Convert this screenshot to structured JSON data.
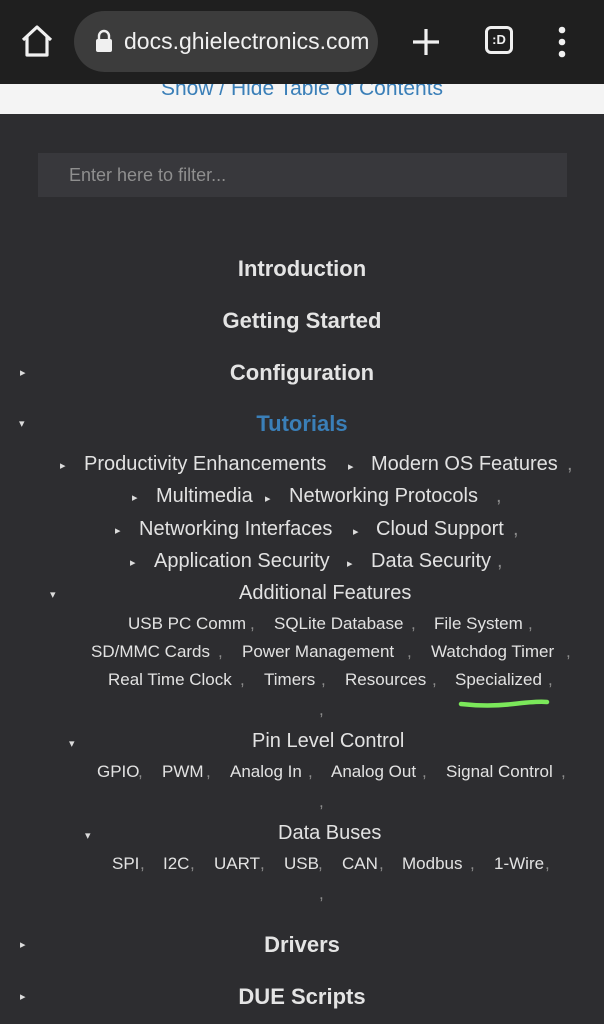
{
  "browser": {
    "url": "docs.ghielectronics.com",
    "tabs_label": ":D"
  },
  "toc": {
    "toggle_label": "Show / Hide Table of Contents",
    "filter_placeholder": "Enter here to filter...",
    "top_items": {
      "introduction": "Introduction",
      "getting_started": "Getting Started",
      "configuration": "Configuration",
      "tutorials": "Tutorials",
      "drivers": "Drivers",
      "due_scripts": "DUE Scripts"
    },
    "tutorials": {
      "productivity": "Productivity Enhancements",
      "modern_os": "Modern OS Features",
      "multimedia": "Multimedia",
      "networking_protocols": "Networking Protocols",
      "networking_interfaces": "Networking Interfaces",
      "cloud_support": "Cloud Support",
      "application_security": "Application Security",
      "data_security": "Data Security",
      "additional_features": "Additional Features",
      "pin_level_control": "Pin Level Control",
      "data_buses": "Data Buses"
    },
    "additional_features_items": [
      "USB PC Comm",
      "SQLite Database",
      "File System",
      "SD/MMC Cards",
      "Power Management",
      "Watchdog Timer",
      "Real Time Clock",
      "Timers",
      "Resources",
      "Specialized"
    ],
    "pin_level_items": [
      "GPIO",
      "PWM",
      "Analog In",
      "Analog Out",
      "Signal Control"
    ],
    "data_bus_items": [
      "SPI",
      "I2C",
      "UART",
      "USB",
      "CAN",
      "Modbus",
      "1-Wire"
    ],
    "separator": ","
  },
  "colors": {
    "background": "#2d2d30",
    "active_link": "#3a7fb8",
    "highlight_underline": "#7be85a"
  }
}
